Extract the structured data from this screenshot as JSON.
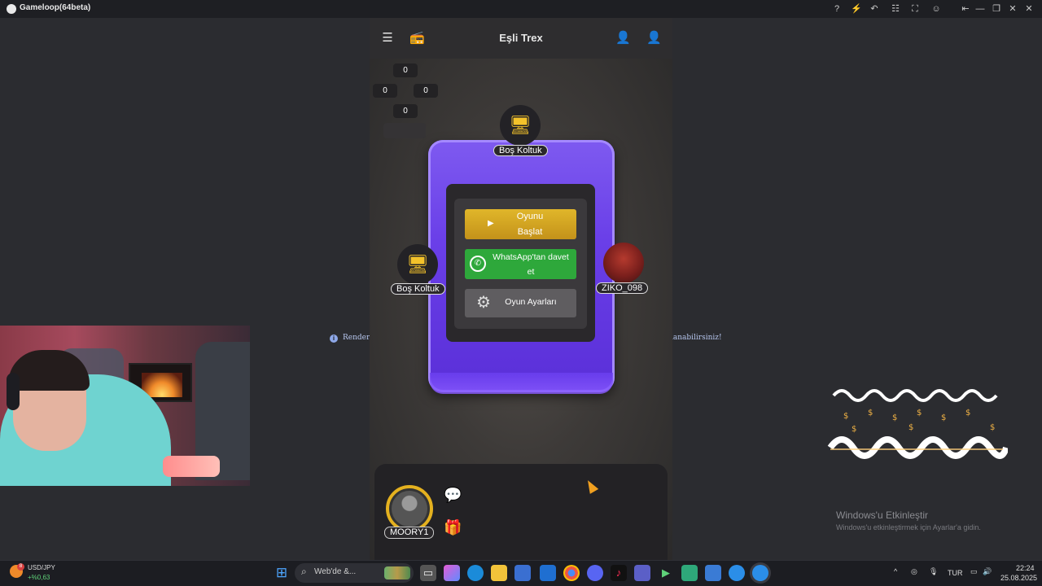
{
  "window": {
    "title": "Gameloop(64beta)",
    "controls": [
      "?",
      "⚡",
      "↶",
      "☷",
      "⛶",
      "☺",
      "⇤",
      "—",
      "❐",
      "✕"
    ]
  },
  "game": {
    "title": "Eşli Trex",
    "scores": {
      "top": "0",
      "left": "0",
      "right": "0",
      "bottom": "0"
    },
    "seats": {
      "top": {
        "label": "Boş Koltuk",
        "icon": "seat-computer-icon"
      },
      "left": {
        "label": "Boş Koltuk",
        "icon": "seat-computer-icon"
      },
      "right": {
        "label": "ZIKO_098",
        "icon": "player-avatar"
      }
    },
    "buttons": {
      "start_line1": "Oyunu",
      "start_line2": "Başlat",
      "whatsapp_line1": "WhatsApp'tan davet",
      "whatsapp_line2": "et",
      "settings": "Oyun Ayarları"
    },
    "player": {
      "name": "MOORY1"
    },
    "notice_left": "Render m",
    "notice_right": "lanabilirsiniz!"
  },
  "overlay": {
    "windows_activate_title": "Windows'u Etkinleştir",
    "windows_activate_sub": "Windows'u etkinleştirmek için Ayarlar'a gidin."
  },
  "taskbar": {
    "ticker_name": "USD/JPY",
    "ticker_change": "+%0,63",
    "ticker_badge": "8",
    "search_placeholder": "Web'de &...",
    "language": "TUR",
    "time": "22:24",
    "date": "25.08.2025"
  },
  "colors": {
    "accent_gold": "#e4b11f",
    "table_purple": "#6a3fe8",
    "whatsapp_green": "#2ea83b"
  }
}
